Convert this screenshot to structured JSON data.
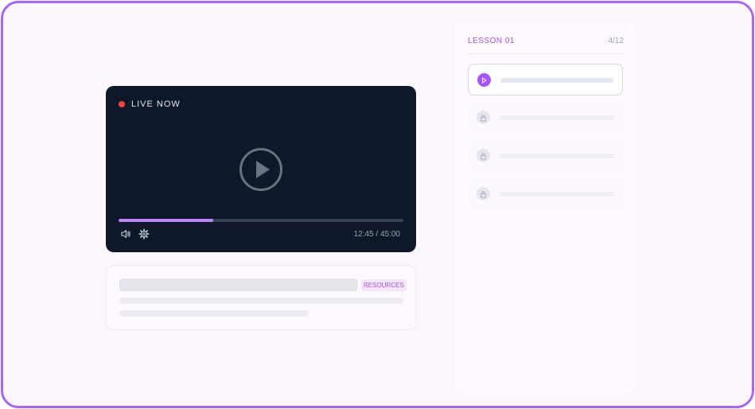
{
  "player": {
    "live_label": "LIVE NOW",
    "time_display": "12:45 / 45:00",
    "progress_fraction": 0.333,
    "accent_color": "#c084fc",
    "icons": [
      "play-icon",
      "volume-icon",
      "settings-icon"
    ]
  },
  "info_card": {
    "badge_label": "RESOURCES"
  },
  "lesson_panel": {
    "title": "LESSON 01",
    "count": "4/12",
    "items": [
      {
        "state": "active",
        "icon": "play-icon"
      },
      {
        "state": "locked",
        "icon": "lock-icon"
      },
      {
        "state": "locked",
        "icon": "lock-icon"
      },
      {
        "state": "locked",
        "icon": "lock-icon"
      }
    ]
  },
  "colors": {
    "brand": "#a855f7",
    "frame_border": "#a965ee",
    "live": "#ef4444",
    "player_bg": "#0f172a"
  }
}
